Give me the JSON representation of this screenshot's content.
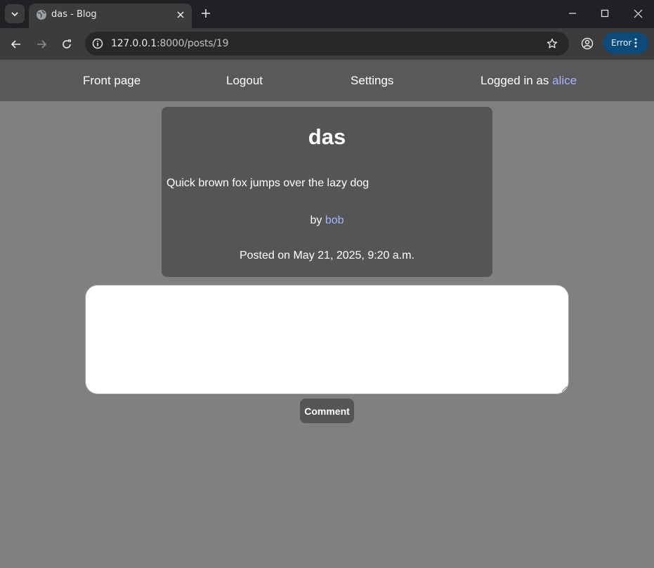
{
  "browser": {
    "tab": {
      "title": "das - Blog",
      "icon": "globe-icon"
    },
    "url": {
      "host": "127.0.0.1",
      "path": ":8000/posts/19"
    },
    "error_label": "Error"
  },
  "nav": {
    "front_page": "Front page",
    "logout": "Logout",
    "settings": "Settings",
    "logged_in_prefix": "Logged in as ",
    "username": "alice"
  },
  "post": {
    "title": "das",
    "body": "Quick brown fox jumps over the lazy dog",
    "author_prefix": "by ",
    "author": "bob",
    "posted": "Posted on May 21, 2025, 9:20 a.m."
  },
  "comment": {
    "value": "",
    "button_label": "Comment"
  },
  "colors": {
    "page_bg": "#808080",
    "nav_bg": "#595959",
    "card_bg": "#555555",
    "link": "#a6b4ff"
  }
}
